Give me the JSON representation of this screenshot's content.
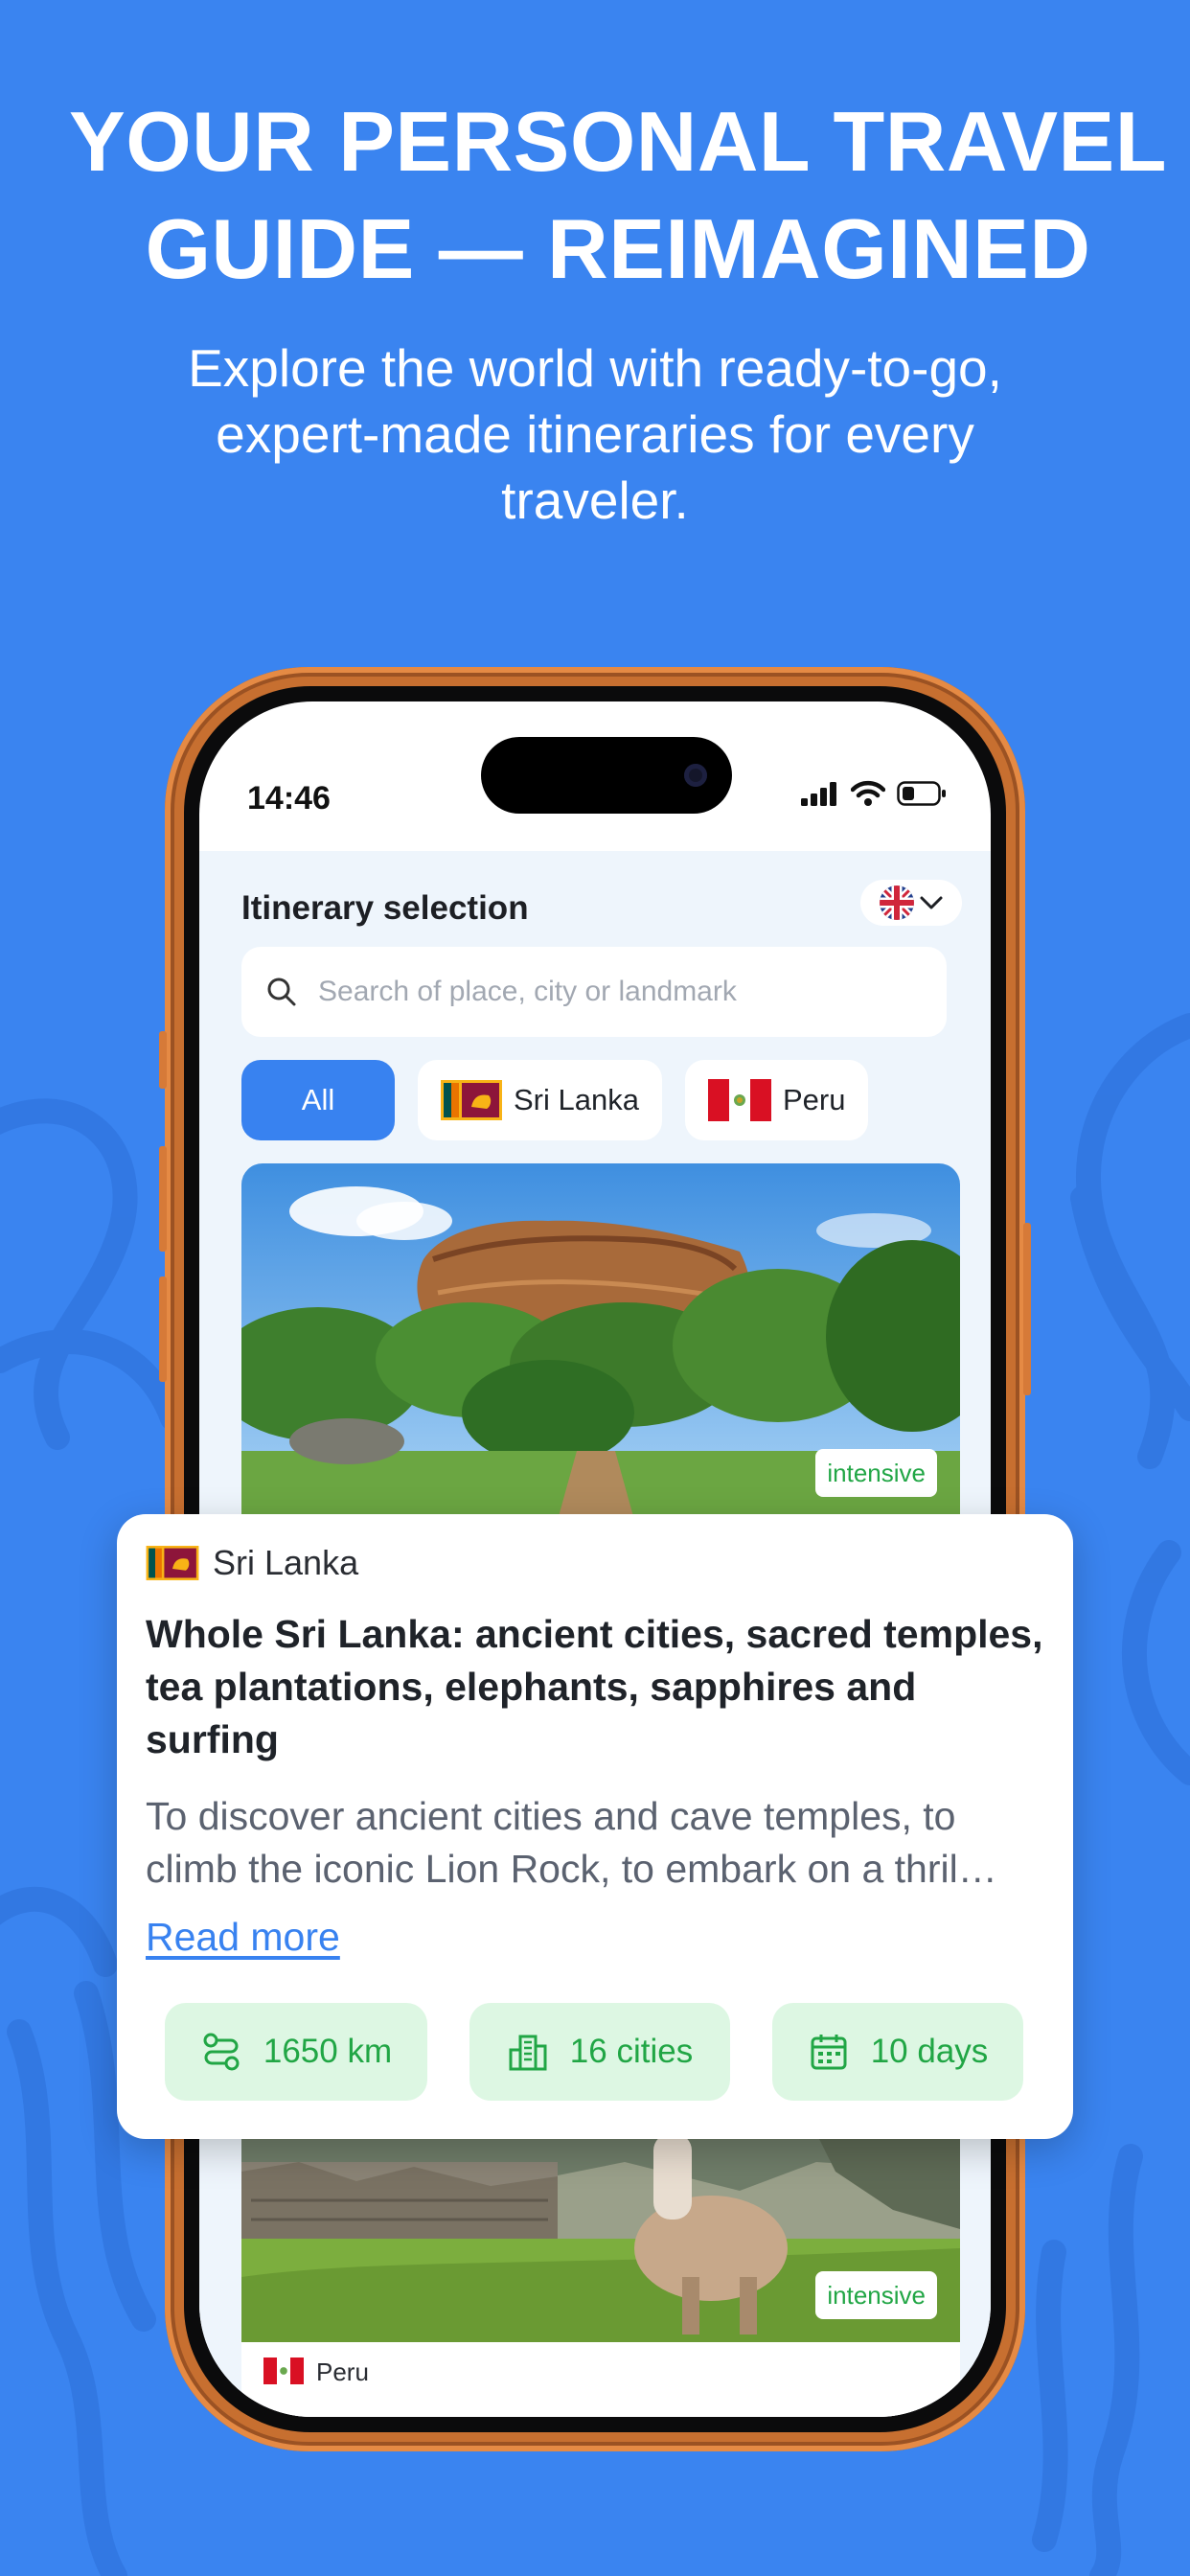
{
  "headline": {
    "line1": "YOUR PERSONAL TRAVEL",
    "line2": "GUIDE — REIMAGINED"
  },
  "subhead": {
    "line1": "Explore the world with ready-to-go,",
    "line2": "expert-made itineraries for every",
    "line3": "traveler."
  },
  "status_bar": {
    "time": "14:46"
  },
  "app": {
    "title": "Itinerary selection",
    "search_placeholder": "Search of place, city or landmark",
    "chips": [
      {
        "label": "All"
      },
      {
        "label": "Sri Lanka"
      },
      {
        "label": "Peru"
      }
    ],
    "cards": [
      {
        "badge": "intensive",
        "country": "Sri Lanka"
      },
      {
        "badge": "intensive",
        "country": "Peru"
      }
    ]
  },
  "featured": {
    "country": "Sri Lanka",
    "title": "Whole Sri Lanka: ancient cities, sacred temples, tea plantations, elephants, sapphires and surfing",
    "description": "To discover ancient cities and cave temples, to climb the iconic Lion Rock, to embark on a thril…",
    "read_more": "Read more",
    "stats": [
      {
        "icon": "route-icon",
        "label": "1650 km"
      },
      {
        "icon": "city-icon",
        "label": "16 cities"
      },
      {
        "icon": "calendar-icon",
        "label": "10 days"
      }
    ]
  },
  "colors": {
    "background": "#3a84f0",
    "accent": "#3882f0",
    "green": "#21a645",
    "phone_frame": "#c76f30"
  }
}
